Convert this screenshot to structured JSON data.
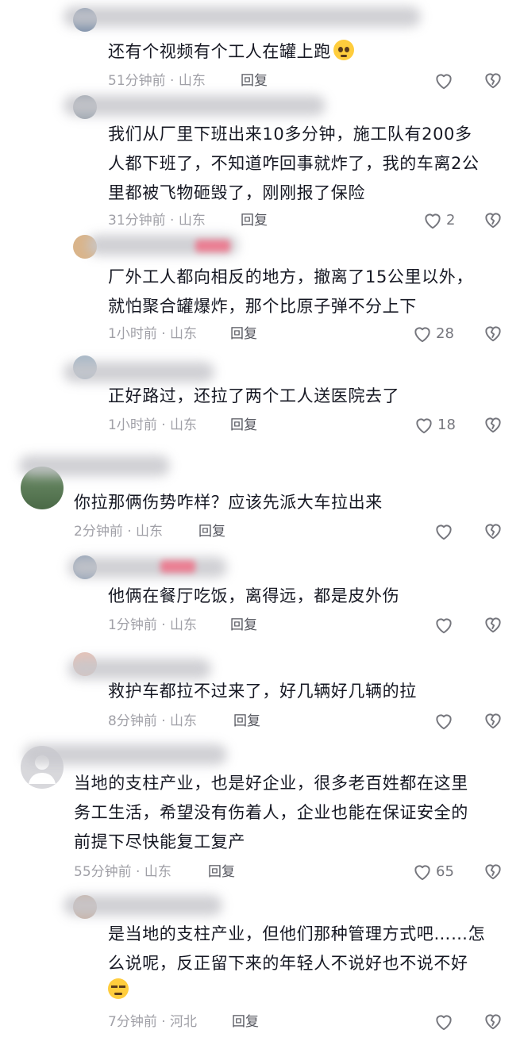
{
  "comments": [
    {
      "text_lines": [
        "还有个视频有个工人在罐上跑"
      ],
      "emoji": "pleading-face",
      "time": "51分钟前 · 山东",
      "reply": "回复",
      "likes": ""
    },
    {
      "text_lines": [
        "我们从厂里下班出来10多分钟，施工队有200多",
        "人都下班了，不知道咋回事就炸了，我的车离2公",
        "里都被飞物砸毁了，刚刚报了保险"
      ],
      "time": "31分钟前 · 山东",
      "reply": "回复",
      "likes": "2"
    },
    {
      "text_lines": [
        "厂外工人都向相反的地方，撤离了15公里以外，",
        "就怕聚合罐爆炸，那个比原子弹不分上下"
      ],
      "time": "1小时前 · 山东",
      "reply": "回复",
      "likes": "28"
    },
    {
      "text_lines": [
        "正好路过，还拉了两个工人送医院去了"
      ],
      "time": "1小时前 · 山东",
      "reply": "回复",
      "likes": "18"
    },
    {
      "text_lines": [
        "你拉那俩伤势咋样？应该先派大车拉出来"
      ],
      "time": "2分钟前 · 山东",
      "reply": "回复",
      "likes": ""
    },
    {
      "text_lines": [
        "他俩在餐厅吃饭，离得远，都是皮外伤"
      ],
      "time": "1分钟前 · 山东",
      "reply": "回复",
      "likes": ""
    },
    {
      "text_lines": [
        "救护车都拉不过来了，好几辆好几辆的拉"
      ],
      "time": "8分钟前 · 山东",
      "reply": "回复",
      "likes": ""
    },
    {
      "text_lines": [
        "当地的支柱产业，也是好企业，很多老百姓都在这里",
        "务工生活，希望没有伤着人，企业也能在保证安全的",
        "前提下尽快能复工复产"
      ],
      "time": "55分钟前 · 山东",
      "reply": "回复",
      "likes": "65"
    },
    {
      "text_lines": [
        "是当地的支柱产业，但他们那种管理方式吧……怎",
        "么说呢，反正留下来的年轻人不说好也不说不好"
      ],
      "emoji_line": "smirk-face",
      "time": "7分钟前 · 河北",
      "reply": "回复",
      "likes": ""
    }
  ],
  "colors": {
    "text": "#161823",
    "meta": "#a0a0a7",
    "reply": "#54565e",
    "icon": "#75767d"
  }
}
